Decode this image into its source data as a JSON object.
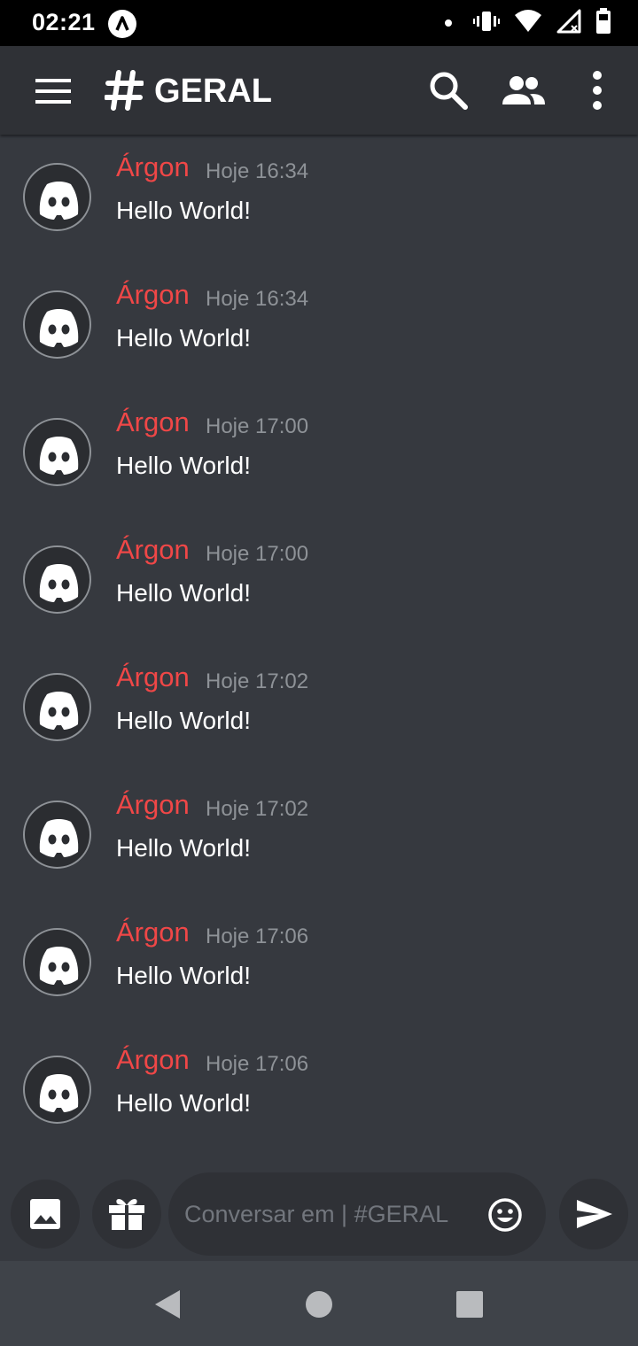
{
  "status_bar": {
    "time": "02:21",
    "icons": [
      "app-notification-icon",
      "dot-icon",
      "vibrate-icon",
      "wifi-icon",
      "signal-icon",
      "battery-icon"
    ]
  },
  "header": {
    "channel_icon": "hash-icon",
    "channel_name": "GERAL",
    "actions": [
      "menu-icon",
      "search-icon",
      "members-icon",
      "more-vert-icon"
    ]
  },
  "messages": [
    {
      "author": "Árgon",
      "time": "Hoje 16:34",
      "text": "Hello World!"
    },
    {
      "author": "Árgon",
      "time": "Hoje 16:34",
      "text": "Hello World!"
    },
    {
      "author": "Árgon",
      "time": "Hoje 17:00",
      "text": "Hello World!"
    },
    {
      "author": "Árgon",
      "time": "Hoje 17:00",
      "text": "Hello World!"
    },
    {
      "author": "Árgon",
      "time": "Hoje 17:02",
      "text": "Hello World!"
    },
    {
      "author": "Árgon",
      "time": "Hoje 17:02",
      "text": "Hello World!"
    },
    {
      "author": "Árgon",
      "time": "Hoje 17:06",
      "text": "Hello World!"
    },
    {
      "author": "Árgon",
      "time": "Hoje 17:06",
      "text": "Hello World!"
    }
  ],
  "composer": {
    "placeholder": "Conversar em | #GERAL",
    "value": "",
    "icons": [
      "image-icon",
      "gift-icon",
      "emoji-icon",
      "send-icon"
    ]
  },
  "nav_bar": {
    "icons": [
      "back-icon",
      "home-icon",
      "recents-icon"
    ]
  },
  "colors": {
    "background": "#36393f",
    "header": "#2f3136",
    "author": "#f04747",
    "timestamp": "#8e9297",
    "text": "#ffffff",
    "nav_bar": "#3f4349"
  }
}
